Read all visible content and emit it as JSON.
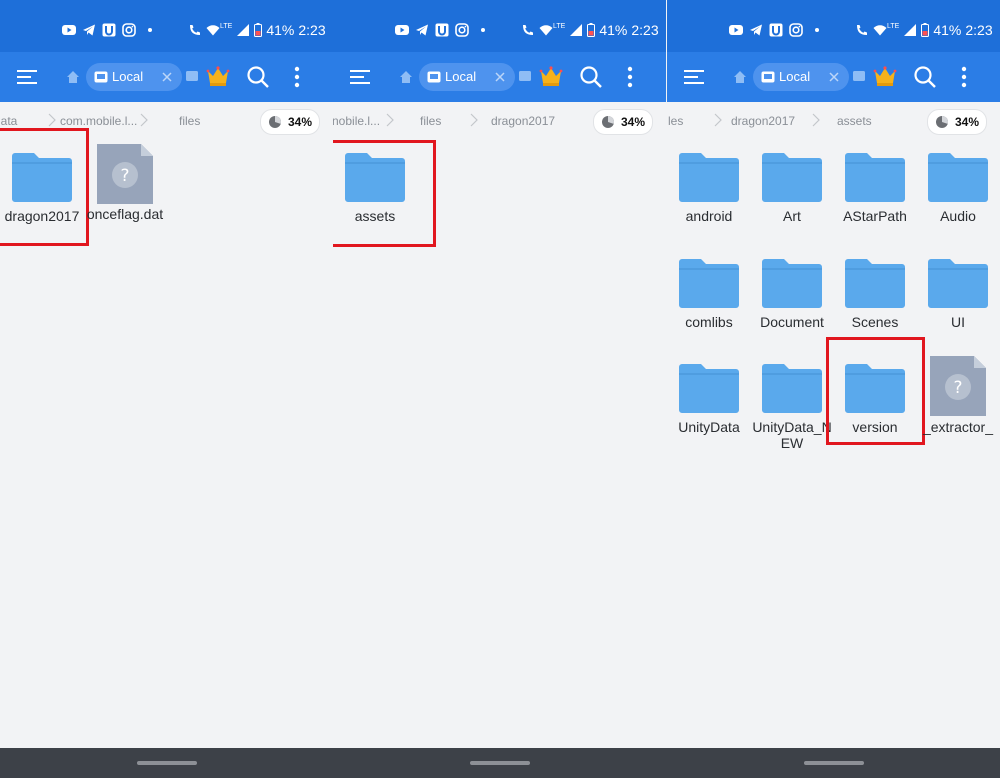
{
  "status_bar": {
    "battery": "41%",
    "time": "2:23",
    "network": "LTE"
  },
  "toolbar": {
    "tab_label": "Local"
  },
  "storage_usage": {
    "label": "34%",
    "fraction": 0.34
  },
  "colors": {
    "accent": "#2b7de6",
    "status_bar": "#1e6fd9",
    "folder": "#5aa9ec",
    "highlight": "#e1161e"
  },
  "panels": [
    {
      "breadcrumb": [
        "lata",
        "com.mobile.l...",
        "files"
      ],
      "items": [
        {
          "name": "dragon2017",
          "type": "folder",
          "highlighted": true
        },
        {
          "name": "onceflag.dat",
          "type": "unknown-file",
          "highlighted": false
        }
      ]
    },
    {
      "breadcrumb": [
        "nobile.l...",
        "files",
        "dragon2017"
      ],
      "items": [
        {
          "name": "assets",
          "type": "folder",
          "highlighted": true
        }
      ]
    },
    {
      "breadcrumb": [
        "les",
        "dragon2017",
        "assets"
      ],
      "items": [
        {
          "name": "android",
          "type": "folder"
        },
        {
          "name": "Art",
          "type": "folder"
        },
        {
          "name": "AStarPath",
          "type": "folder"
        },
        {
          "name": "Audio",
          "type": "folder"
        },
        {
          "name": "comlibs",
          "type": "folder"
        },
        {
          "name": "Document",
          "type": "folder"
        },
        {
          "name": "Scenes",
          "type": "folder"
        },
        {
          "name": "UI",
          "type": "folder"
        },
        {
          "name": "UnityData",
          "type": "folder"
        },
        {
          "name": "UnityData_NEW",
          "type": "folder"
        },
        {
          "name": "version",
          "type": "folder",
          "highlighted": true
        },
        {
          "name": "_extractor_",
          "type": "unknown-file"
        }
      ]
    }
  ]
}
